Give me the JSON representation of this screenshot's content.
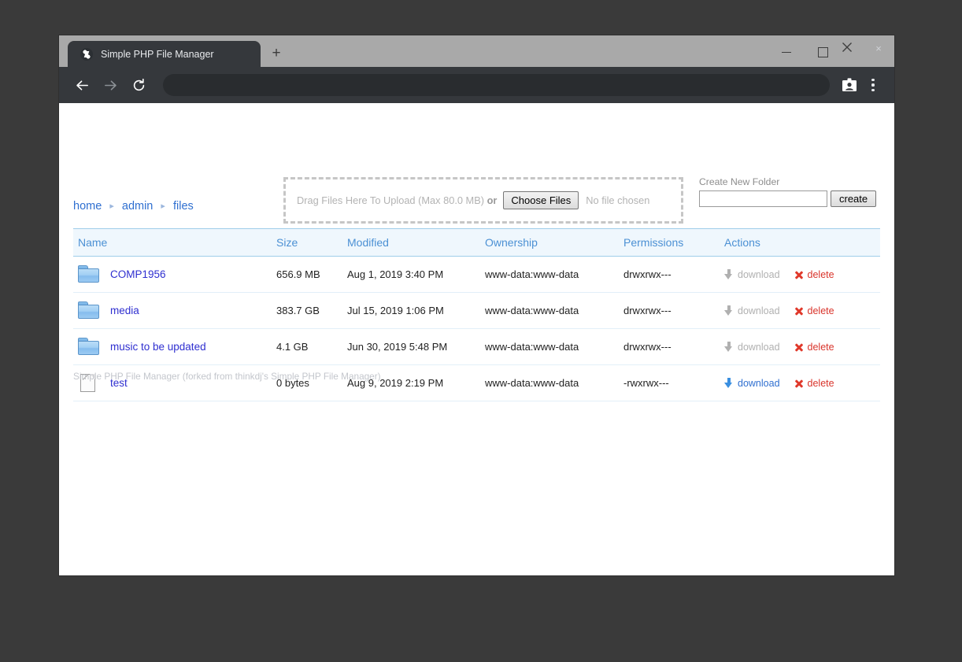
{
  "browser": {
    "tab_title": "Simple PHP File Manager",
    "favicon_name": "php-file-manager-favicon",
    "tab_close_label": "×",
    "new_tab_label": "+",
    "window_controls": {
      "minimize": "—",
      "maximize": "□",
      "close": "✕"
    },
    "toolbar": {
      "back_label": "back",
      "forward_label": "forward",
      "reload_label": "reload",
      "address_value": "",
      "profile_label": "profile",
      "menu_label": "menu"
    }
  },
  "page": {
    "breadcrumb": {
      "items": [
        "home",
        "admin",
        "files"
      ],
      "separator": "▸"
    },
    "upload": {
      "hint_prefix": "Drag Files Here To Upload (Max 80.0 MB)",
      "or_label": "or",
      "choose_button": "Choose Files",
      "no_file_text": "No file chosen"
    },
    "create_folder": {
      "label": "Create New Folder",
      "input_value": "",
      "input_placeholder": "",
      "button": "create"
    },
    "table": {
      "columns": [
        "Name",
        "Size",
        "Modified",
        "Ownership",
        "Permissions",
        "Actions"
      ],
      "rows": [
        {
          "icon": "folder-icon",
          "type": "folder",
          "name": "COMP1956",
          "size": "656.9 MB",
          "modified": "Aug 1, 2019 3:40 PM",
          "ownership": "www-data:www-data",
          "permissions": "drwxrwx---",
          "download_label": "download",
          "download_enabled": false,
          "delete_label": "delete"
        },
        {
          "icon": "folder-icon",
          "type": "folder",
          "name": "media",
          "size": "383.7 GB",
          "modified": "Jul 15, 2019 1:06 PM",
          "ownership": "www-data:www-data",
          "permissions": "drwxrwx---",
          "download_label": "download",
          "download_enabled": false,
          "delete_label": "delete"
        },
        {
          "icon": "folder-icon",
          "type": "folder",
          "name": "music to be updated",
          "size": "4.1 GB",
          "modified": "Jun 30, 2019 5:48 PM",
          "ownership": "www-data:www-data",
          "permissions": "drwxrwx---",
          "download_label": "download",
          "download_enabled": false,
          "delete_label": "delete"
        },
        {
          "icon": "file-icon",
          "type": "file",
          "name": "test",
          "size": "0 bytes",
          "modified": "Aug 9, 2019 2:19 PM",
          "ownership": "www-data:www-data",
          "permissions": "-rwxrwx---",
          "download_label": "download",
          "download_enabled": true,
          "delete_label": "delete"
        }
      ]
    },
    "footer": "Simple PHP File Manager (forked from thinkdj's Simple PHP File Manager)"
  },
  "colors": {
    "link_blue": "#2f2fd0",
    "header_blue": "#4b90d4",
    "header_bg": "#eff7fd",
    "delete_red": "#d9342b",
    "download_active": "#2f6fd0",
    "download_disabled": "#b0b0b0",
    "desktop_bg": "#3a3a3a",
    "chrome_tabstrip": "#a9a9a9",
    "chrome_toolbar": "#35383c"
  }
}
